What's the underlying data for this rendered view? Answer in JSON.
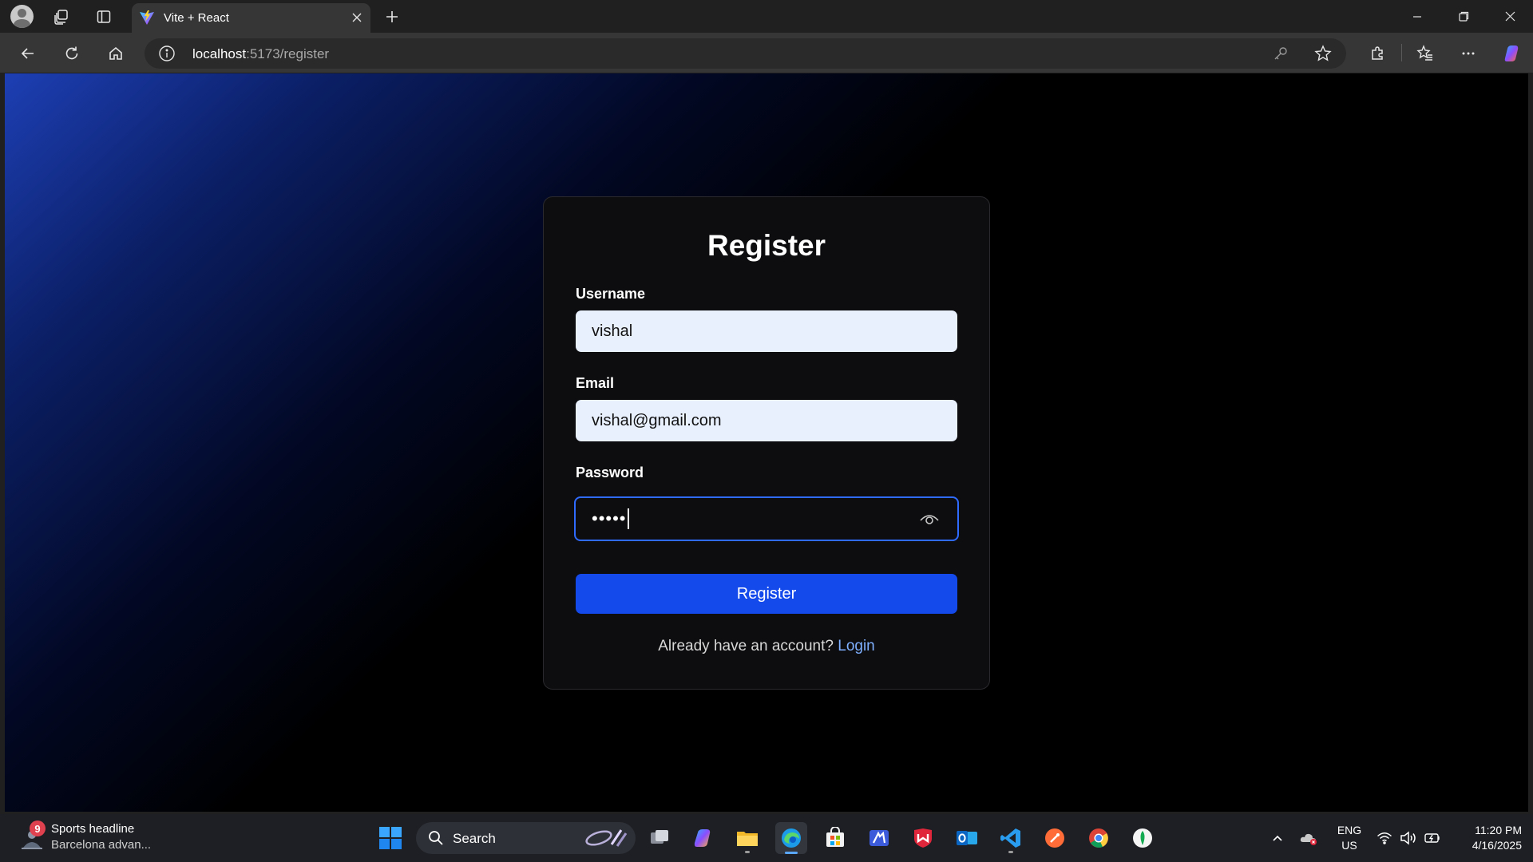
{
  "browser": {
    "tab": {
      "title": "Vite + React"
    },
    "address": {
      "host": "localhost",
      "path": ":5173/register"
    }
  },
  "page": {
    "title": "Register",
    "username": {
      "label": "Username",
      "value": "vishal"
    },
    "email": {
      "label": "Email",
      "value": "vishal@gmail.com"
    },
    "password": {
      "label": "Password",
      "masked_value": "•••••"
    },
    "submit_label": "Register",
    "footer": {
      "prompt": "Already have an account?",
      "link": "Login"
    }
  },
  "taskbar": {
    "news": {
      "badge": "9",
      "title": "Sports headline",
      "subtitle": "Barcelona advan..."
    },
    "search_label": "Search",
    "language": {
      "line1": "ENG",
      "line2": "US"
    },
    "clock": {
      "time": "11:20 PM",
      "date": "4/16/2025"
    }
  },
  "colors": {
    "accent": "#1449ec",
    "link": "#7fb0ff",
    "focus_ring": "#2f6bff",
    "input_bg": "#e8f0fe"
  }
}
